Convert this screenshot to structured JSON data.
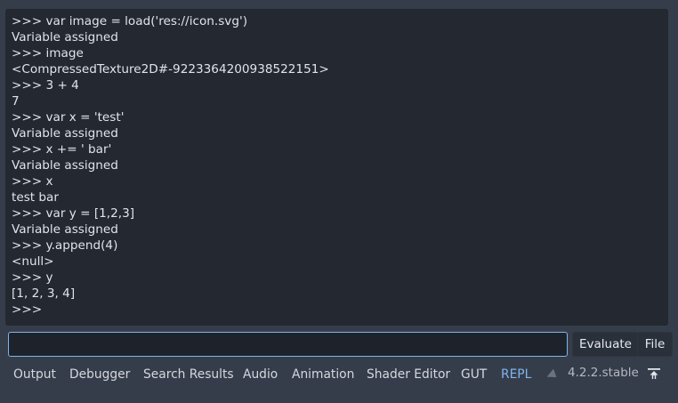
{
  "output": {
    "lines": [
      ">>> var image = load('res://icon.svg')",
      "Variable assigned",
      ">>> image",
      "<CompressedTexture2D#-9223364200938522151>",
      ">>> 3 + 4",
      "7",
      ">>> var x = 'test'",
      "Variable assigned",
      ">>> x += ' bar'",
      "Variable assigned",
      ">>> x",
      "test bar",
      ">>> var y = [1,2,3]",
      "Variable assigned",
      ">>> y.append(4)",
      "<null>",
      ">>> y",
      "[1, 2, 3, 4]",
      ">>>"
    ]
  },
  "input": {
    "value": "",
    "placeholder": ""
  },
  "buttons": {
    "evaluate": "Evaluate",
    "file": "File"
  },
  "bottom_panel": {
    "tabs": [
      {
        "label": "Output"
      },
      {
        "label": "Debugger"
      },
      {
        "label": "Search Results"
      },
      {
        "label": "Audio"
      },
      {
        "label": "Animation"
      },
      {
        "label": "Shader Editor"
      },
      {
        "label": "GUT"
      },
      {
        "label": "REPL"
      }
    ],
    "active_tab": "REPL",
    "version": "4.2.2.stable"
  },
  "icons": {
    "pin": "pin-icon",
    "collapse": "collapse-panel-icon"
  },
  "colors": {
    "accent": "#7fb4ec",
    "background": "#363d4a",
    "panel": "#232831"
  }
}
